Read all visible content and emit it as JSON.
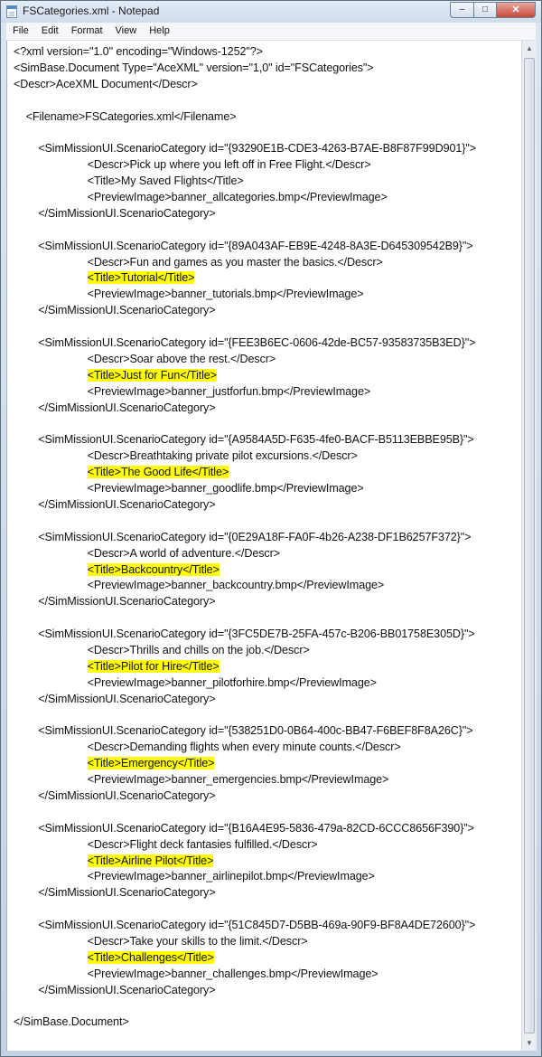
{
  "window": {
    "title": "FSCategories.xml - Notepad",
    "min_glyph": "–",
    "max_glyph": "□",
    "close_glyph": "✕"
  },
  "menu": [
    "File",
    "Edit",
    "Format",
    "View",
    "Help"
  ],
  "scrollbar": {
    "up_glyph": "▲",
    "down_glyph": "▼"
  },
  "lines": [
    {
      "text": "<?xml version=\"1.0\" encoding=\"Windows-1252\"?>"
    },
    {
      "text": "<SimBase.Document Type=\"AceXML\" version=\"1,0\" id=\"FSCategories\">"
    },
    {
      "text": "<Descr>AceXML Document</Descr>"
    },
    {
      "text": ""
    },
    {
      "text": "    <Filename>FSCategories.xml</Filename>"
    },
    {
      "text": ""
    },
    {
      "text": "        <SimMissionUI.ScenarioCategory id=\"{93290E1B-CDE3-4263-B7AE-B8F87F99D901}\">"
    },
    {
      "text": "                        <Descr>Pick up where you left off in Free Flight.</Descr>"
    },
    {
      "text": "                        <Title>My Saved Flights</Title>"
    },
    {
      "text": "                        <PreviewImage>banner_allcategories.bmp</PreviewImage>"
    },
    {
      "text": "        </SimMissionUI.ScenarioCategory>"
    },
    {
      "text": ""
    },
    {
      "text": "        <SimMissionUI.ScenarioCategory id=\"{89A043AF-EB9E-4248-8A3E-D645309542B9}\">"
    },
    {
      "text": "                        <Descr>Fun and games as you master the basics.</Descr>"
    },
    {
      "indent": "                        ",
      "hl": "<Title>Tutorial</Title>"
    },
    {
      "text": "                        <PreviewImage>banner_tutorials.bmp</PreviewImage>"
    },
    {
      "text": "        </SimMissionUI.ScenarioCategory>"
    },
    {
      "text": ""
    },
    {
      "text": "        <SimMissionUI.ScenarioCategory id=\"{FEE3B6EC-0606-42de-BC57-93583735B3ED}\">"
    },
    {
      "text": "                        <Descr>Soar above the rest.</Descr>"
    },
    {
      "indent": "                        ",
      "hl": "<Title>Just for Fun</Title>"
    },
    {
      "text": "                        <PreviewImage>banner_justforfun.bmp</PreviewImage>"
    },
    {
      "text": "        </SimMissionUI.ScenarioCategory>"
    },
    {
      "text": ""
    },
    {
      "text": "        <SimMissionUI.ScenarioCategory id=\"{A9584A5D-F635-4fe0-BACF-B5113EBBE95B}\">"
    },
    {
      "text": "                        <Descr>Breathtaking private pilot excursions.</Descr>"
    },
    {
      "indent": "                        ",
      "hl": "<Title>The Good Life</Title>"
    },
    {
      "text": "                        <PreviewImage>banner_goodlife.bmp</PreviewImage>"
    },
    {
      "text": "        </SimMissionUI.ScenarioCategory>"
    },
    {
      "text": ""
    },
    {
      "text": "        <SimMissionUI.ScenarioCategory id=\"{0E29A18F-FA0F-4b26-A238-DF1B6257F372}\">"
    },
    {
      "text": "                        <Descr>A world of adventure.</Descr>"
    },
    {
      "indent": "                        ",
      "hl": "<Title>Backcountry</Title>"
    },
    {
      "text": "                        <PreviewImage>banner_backcountry.bmp</PreviewImage>"
    },
    {
      "text": "        </SimMissionUI.ScenarioCategory>"
    },
    {
      "text": ""
    },
    {
      "text": "        <SimMissionUI.ScenarioCategory id=\"{3FC5DE7B-25FA-457c-B206-BB01758E305D}\">"
    },
    {
      "text": "                        <Descr>Thrills and chills on the job.</Descr>"
    },
    {
      "indent": "                        ",
      "hl": "<Title>Pilot for Hire</Title>"
    },
    {
      "text": "                        <PreviewImage>banner_pilotforhire.bmp</PreviewImage>"
    },
    {
      "text": "        </SimMissionUI.ScenarioCategory>"
    },
    {
      "text": ""
    },
    {
      "text": "        <SimMissionUI.ScenarioCategory id=\"{538251D0-0B64-400c-BB47-F6BEF8F8A26C}\">"
    },
    {
      "text": "                        <Descr>Demanding flights when every minute counts.</Descr>"
    },
    {
      "indent": "                        ",
      "hl": "<Title>Emergency</Title>"
    },
    {
      "text": "                        <PreviewImage>banner_emergencies.bmp</PreviewImage>"
    },
    {
      "text": "        </SimMissionUI.ScenarioCategory>"
    },
    {
      "text": ""
    },
    {
      "text": "        <SimMissionUI.ScenarioCategory id=\"{B16A4E95-5836-479a-82CD-6CCC8656F390}\">"
    },
    {
      "text": "                        <Descr>Flight deck fantasies fulfilled.</Descr>"
    },
    {
      "indent": "                        ",
      "hl": "<Title>Airline Pilot</Title>"
    },
    {
      "text": "                        <PreviewImage>banner_airlinepilot.bmp</PreviewImage>"
    },
    {
      "text": "        </SimMissionUI.ScenarioCategory>"
    },
    {
      "text": ""
    },
    {
      "text": "        <SimMissionUI.ScenarioCategory id=\"{51C845D7-D5BB-469a-90F9-BF8A4DE72600}\">"
    },
    {
      "text": "                        <Descr>Take your skills to the limit.</Descr>"
    },
    {
      "indent": "                        ",
      "hl": "<Title>Challenges</Title>"
    },
    {
      "text": "                        <PreviewImage>banner_challenges.bmp</PreviewImage>"
    },
    {
      "text": "        </SimMissionUI.ScenarioCategory>"
    },
    {
      "text": ""
    },
    {
      "text": "</SimBase.Document>"
    }
  ]
}
